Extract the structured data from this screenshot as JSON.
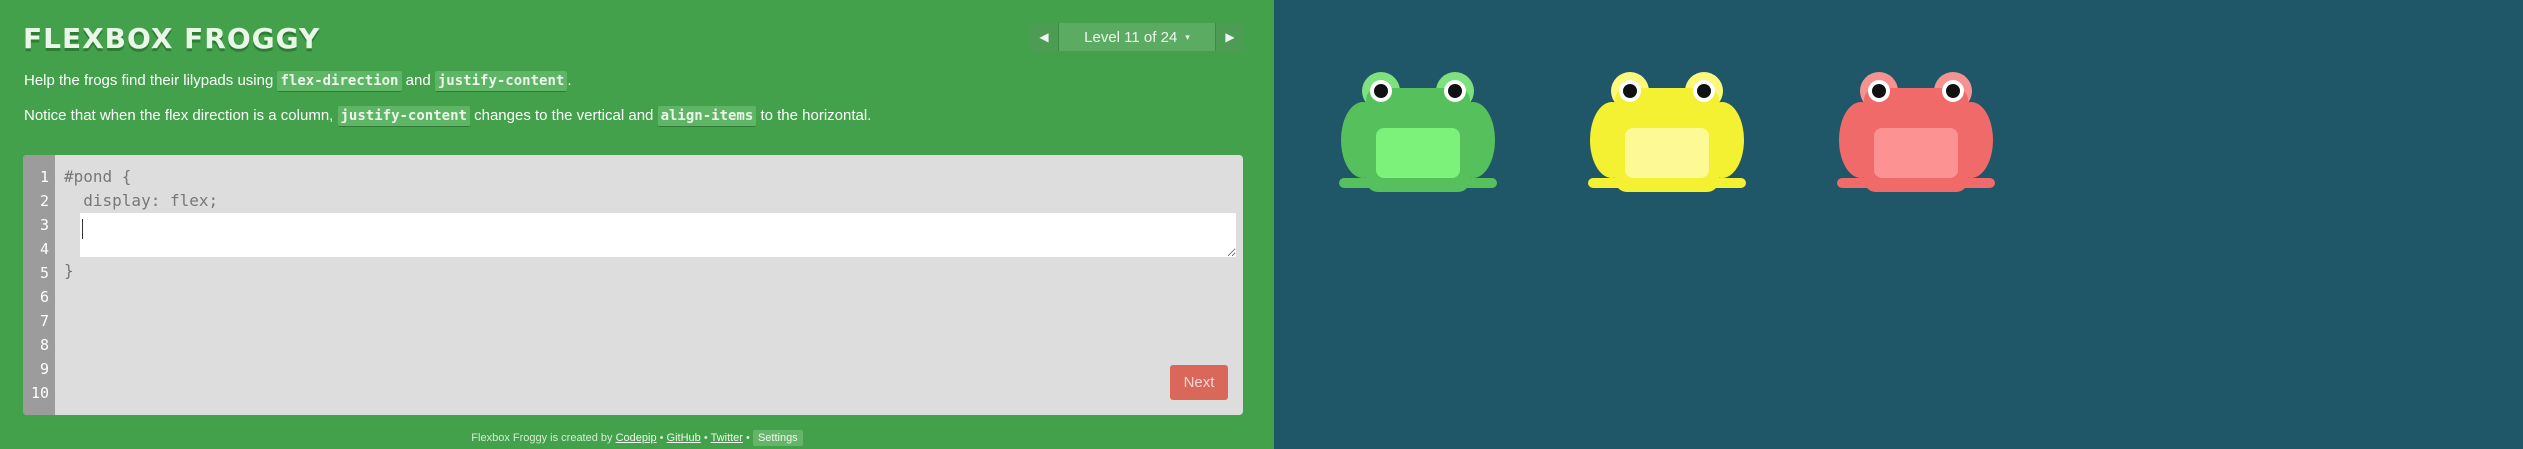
{
  "app": {
    "title": "FLEXBOX FROGGY"
  },
  "level_nav": {
    "label": "Level 11 of 24",
    "caret": "▾",
    "prev": "◀",
    "next": "▶"
  },
  "instructions": {
    "line1": {
      "before": "Help the frogs find their lilypads using ",
      "code1": "flex-direction",
      "mid": " and ",
      "code2": "justify-content",
      "after": "."
    },
    "line2": {
      "before": "Notice that when the flex direction is a column, ",
      "code1": "justify-content",
      "mid": " changes to the vertical and ",
      "code2": "align-items",
      "after": " to the horizontal."
    }
  },
  "editor": {
    "line_numbers": [
      "1",
      "2",
      "3",
      "4",
      "5",
      "6",
      "7",
      "8",
      "9",
      "10"
    ],
    "code_before": [
      "#pond {",
      "  display: flex;"
    ],
    "input_value": "",
    "code_after": [
      "}"
    ]
  },
  "next_button": {
    "label": "Next"
  },
  "footer": {
    "text": "Flexbox Froggy is created by ",
    "codepip": "Codepip",
    "sep1": " • ",
    "github": "GitHub",
    "sep2": " • ",
    "twitter": "Twitter",
    "sep3": " • ",
    "settings": "Settings"
  },
  "frogs": [
    {
      "color": "green",
      "body": "#56c15c",
      "belly": "#7cf27a",
      "eyes": "#7fe07e"
    },
    {
      "color": "yellow",
      "body": "#f4f032",
      "belly": "#fdf995",
      "eyes": "#fbf87c"
    },
    {
      "color": "red",
      "body": "#f06a6a",
      "belly": "#fc9292",
      "eyes": "#f59393"
    }
  ]
}
